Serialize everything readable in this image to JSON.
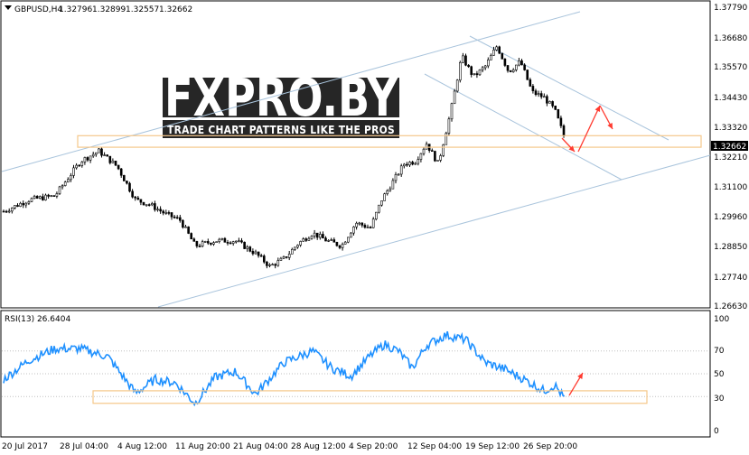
{
  "header": {
    "symbol": "GBPUSD,H4",
    "open": "1.32796",
    "high": "1.32899",
    "low": "1.32557",
    "close": "1.32662"
  },
  "watermark": {
    "brand": "FXPRO.BY",
    "tagline": "TRADE CHART PATTERNS LIKE THE PROS"
  },
  "price_axis": {
    "ticks": [
      "1.37790",
      "1.36680",
      "1.35570",
      "1.34430",
      "1.33320",
      "1.32210",
      "1.31100",
      "1.29960",
      "1.28850",
      "1.27740",
      "1.26630"
    ],
    "current_price": "1.32662"
  },
  "rsi": {
    "label": "RSI(13) 26.6404",
    "ticks": [
      "100",
      "70",
      "50",
      "30",
      "0"
    ]
  },
  "time_axis": {
    "labels": [
      "20 Jul 2017",
      "28 Jul 04:00",
      "4 Aug 12:00",
      "11 Aug 20:00",
      "21 Aug 04:00",
      "28 Aug 12:00",
      "4 Sep 20:00",
      "12 Sep 04:00",
      "19 Sep 12:00",
      "26 Sep 20:00"
    ]
  },
  "colors": {
    "candle": "#000000",
    "rsi_line": "#1e90ff",
    "channel": "#a9c4dc",
    "support_box": "#f5c78a",
    "arrow": "#ff3b30",
    "current_price_bg": "#000000"
  },
  "chart_data": [
    {
      "type": "candlestick",
      "title": "GBPUSD,H4",
      "ylim": [
        1.2625,
        1.3795
      ],
      "close_path": [
        {
          "x": "20 Jul 2017",
          "y": 1.2995
        },
        {
          "x": "24 Jul",
          "y": 1.304
        },
        {
          "x": "26 Jul",
          "y": 1.3055
        },
        {
          "x": "28 Jul 04:00",
          "y": 1.319
        },
        {
          "x": "31 Jul",
          "y": 1.323
        },
        {
          "x": "2 Aug",
          "y": 1.317
        },
        {
          "x": "4 Aug 12:00",
          "y": 1.304
        },
        {
          "x": "7 Aug",
          "y": 1.302
        },
        {
          "x": "9 Aug",
          "y": 1.2985
        },
        {
          "x": "10 Aug",
          "y": 1.296
        },
        {
          "x": "11 Aug 20:00",
          "y": 1.286
        },
        {
          "x": "15 Aug",
          "y": 1.288
        },
        {
          "x": "17 Aug",
          "y": 1.288
        },
        {
          "x": "21 Aug 04:00",
          "y": 1.283
        },
        {
          "x": "23 Aug",
          "y": 1.278
        },
        {
          "x": "24 Aug",
          "y": 1.281
        },
        {
          "x": "25 Aug",
          "y": 1.287
        },
        {
          "x": "28 Aug 12:00",
          "y": 1.291
        },
        {
          "x": "30 Aug",
          "y": 1.288
        },
        {
          "x": "31 Aug",
          "y": 1.286
        },
        {
          "x": "1 Sep",
          "y": 1.295
        },
        {
          "x": "4 Sep 20:00",
          "y": 1.293
        },
        {
          "x": "5 Sep",
          "y": 1.304
        },
        {
          "x": "7 Sep",
          "y": 1.311
        },
        {
          "x": "8 Sep",
          "y": 1.318
        },
        {
          "x": "11 Sep",
          "y": 1.319
        },
        {
          "x": "12 Sep 04:00",
          "y": 1.326
        },
        {
          "x": "13 Sep",
          "y": 1.318
        },
        {
          "x": "14 Sep",
          "y": 1.337
        },
        {
          "x": "15 Sep",
          "y": 1.36
        },
        {
          "x": "18 Sep",
          "y": 1.352
        },
        {
          "x": "19 Sep 12:00",
          "y": 1.356
        },
        {
          "x": "20 Sep",
          "y": 1.364
        },
        {
          "x": "21 Sep",
          "y": 1.354
        },
        {
          "x": "22 Sep",
          "y": 1.358
        },
        {
          "x": "25 Sep",
          "y": 1.346
        },
        {
          "x": "26 Sep 20:00",
          "y": 1.344
        },
        {
          "x": "27 Sep",
          "y": 1.339
        },
        {
          "x": "28 Sep",
          "y": 1.327
        }
      ]
    },
    {
      "type": "line",
      "title": "RSI(13) 26.6404",
      "ylim": [
        0,
        100
      ],
      "levels": [
        30,
        50,
        70
      ],
      "series": [
        {
          "values": [
            {
              "x": "20 Jul 2017",
              "y": 45
            },
            {
              "x": "24 Jul",
              "y": 62
            },
            {
              "x": "26 Jul",
              "y": 72
            },
            {
              "x": "28 Jul 04:00",
              "y": 72
            },
            {
              "x": "2 Aug",
              "y": 65
            },
            {
              "x": "4 Aug 12:00",
              "y": 33
            },
            {
              "x": "7 Aug",
              "y": 45
            },
            {
              "x": "9 Aug",
              "y": 42
            },
            {
              "x": "11 Aug 20:00",
              "y": 24
            },
            {
              "x": "15 Aug",
              "y": 47
            },
            {
              "x": "17 Aug",
              "y": 52
            },
            {
              "x": "21 Aug 04:00",
              "y": 32
            },
            {
              "x": "24 Aug",
              "y": 60
            },
            {
              "x": "28 Aug 12:00",
              "y": 70
            },
            {
              "x": "31 Aug",
              "y": 55
            },
            {
              "x": "1 Sep",
              "y": 48
            },
            {
              "x": "4 Sep 20:00",
              "y": 66
            },
            {
              "x": "5 Sep",
              "y": 76
            },
            {
              "x": "8 Sep",
              "y": 70
            },
            {
              "x": "11 Sep",
              "y": 55
            },
            {
              "x": "12 Sep 04:00",
              "y": 75
            },
            {
              "x": "14 Sep",
              "y": 84
            },
            {
              "x": "15 Sep",
              "y": 80
            },
            {
              "x": "19 Sep 12:00",
              "y": 60
            },
            {
              "x": "21 Sep",
              "y": 54
            },
            {
              "x": "23 Sep",
              "y": 45
            },
            {
              "x": "26 Sep 20:00",
              "y": 35
            },
            {
              "x": "27 Sep",
              "y": 40
            },
            {
              "x": "28 Sep",
              "y": 27
            }
          ]
        }
      ]
    }
  ]
}
